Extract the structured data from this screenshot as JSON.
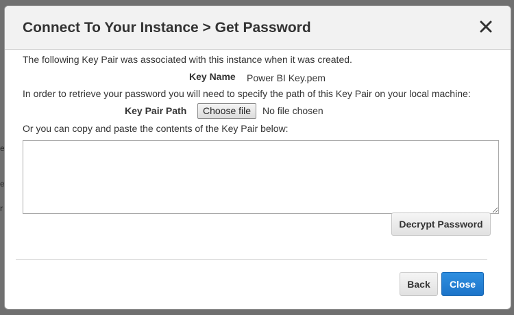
{
  "dialog": {
    "title": "Connect To Your Instance > Get Password",
    "intro": "The following Key Pair was associated with this instance when it was created.",
    "key_name_label": "Key Name",
    "key_name_value": "Power BI Key.pem",
    "retrieve_instruction": "In order to retrieve your password you will need to specify the path of this Key Pair on your local machine:",
    "key_pair_path_label": "Key Pair Path",
    "choose_file_label": "Choose file",
    "file_status": "No file chosen",
    "paste_instruction": "Or you can copy and paste the contents of the Key Pair below:",
    "key_contents_value": "",
    "decrypt_button": "Decrypt Password",
    "back_button": "Back",
    "close_button": "Close"
  },
  "icons": {
    "close": "close-icon"
  },
  "colors": {
    "header_bg": "#f2f2f2",
    "primary": "#1c74c9",
    "text": "#333333"
  }
}
